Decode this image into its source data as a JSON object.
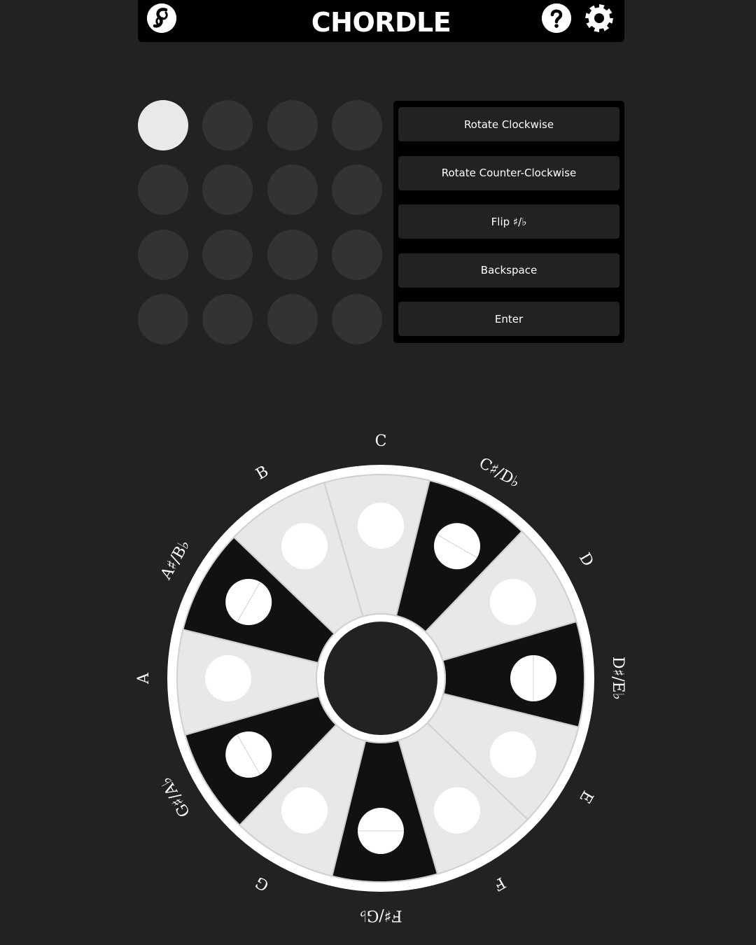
{
  "header": {
    "title": "CHORDLE",
    "logo_icon": "swirl-logo-icon",
    "help_icon": "question-icon",
    "settings_icon": "gear-icon"
  },
  "guess_grid": {
    "rows": 4,
    "cols": 4,
    "active_index": 0
  },
  "controls": [
    {
      "label": "Rotate Clockwise"
    },
    {
      "label": "Rotate Counter-Clockwise"
    },
    {
      "label": "Flip ♯/♭"
    },
    {
      "label": "Backspace"
    },
    {
      "label": "Enter"
    }
  ],
  "wheel": {
    "notes": [
      {
        "name": "C",
        "key": "white"
      },
      {
        "name": "C♯/D♭",
        "key": "black"
      },
      {
        "name": "D",
        "key": "white"
      },
      {
        "name": "D♯/E♭",
        "key": "black"
      },
      {
        "name": "E",
        "key": "white"
      },
      {
        "name": "F",
        "key": "white"
      },
      {
        "name": "F♯/G♭",
        "key": "black"
      },
      {
        "name": "G",
        "key": "white"
      },
      {
        "name": "G♯/A♭",
        "key": "black"
      },
      {
        "name": "A",
        "key": "white"
      },
      {
        "name": "A♯/B♭",
        "key": "black"
      },
      {
        "name": "B",
        "key": "white"
      }
    ]
  },
  "colors": {
    "background": "#222222",
    "header": "#000000",
    "white_key": "#e8e8e8",
    "black_key": "#111111",
    "empty_cell": "#333333",
    "active_cell": "#e9e9e9"
  }
}
